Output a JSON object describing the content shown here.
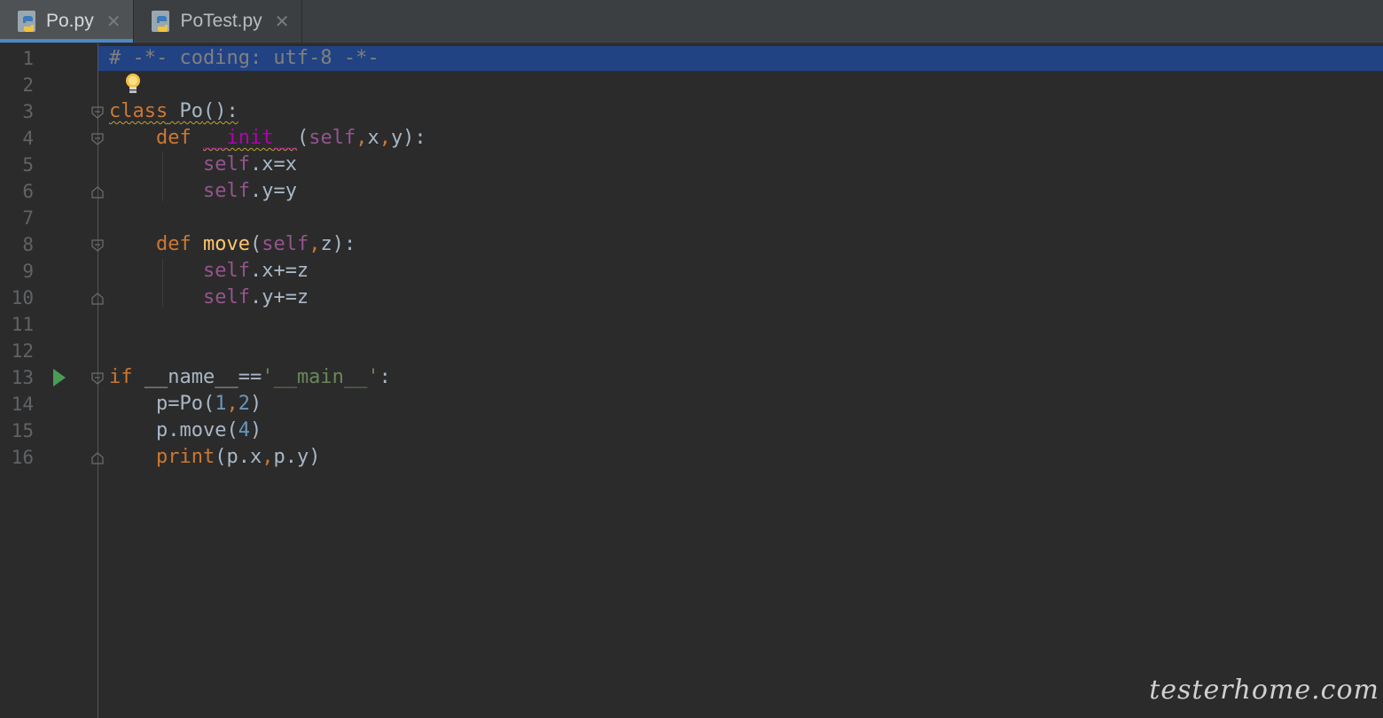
{
  "tabs": [
    {
      "label": "Po.py",
      "active": true
    },
    {
      "label": "PoTest.py",
      "active": false
    }
  ],
  "close_glyph": "✕",
  "line_numbers": [
    "1",
    "2",
    "3",
    "4",
    "5",
    "6",
    "7",
    "8",
    "9",
    "10",
    "11",
    "12",
    "13",
    "14",
    "15",
    "16"
  ],
  "code": {
    "l1": "# -*- coding: utf-8 -*-",
    "l3_kw": "class",
    "l3_name": "Po",
    "l3_rest": "():",
    "l4_kw": "def",
    "l4_name": "__init__",
    "l5_self": "self",
    "l5_rest": ".x=x",
    "l6_self": "self",
    "l6_rest": ".y=y",
    "l8_kw": "def",
    "l8_name": "move",
    "l9_self": "self",
    "l9_rest": ".x+=z",
    "l10_self": "self",
    "l10_rest": ".y+=z",
    "l13_kw": "if",
    "l13_mid": "__name__==",
    "l13_str": "'__main__'",
    "l13_end": ":",
    "l14_a": "p=Po(",
    "l14_n1": "1",
    "l14_n2": "2",
    "l14_end": ")",
    "l15_a": "p.move(",
    "l15_n": "4",
    "l15_end": ")",
    "l16_fn": "print",
    "l16_a": "(p.x",
    "l16_b": "p.y)"
  },
  "colors": {
    "background": "#2b2b2b",
    "keyword": "#cc7832",
    "self": "#94558d",
    "function": "#ffc66d",
    "string": "#6a8759",
    "number": "#6897bb",
    "comment": "#808080",
    "selection": "#214283"
  },
  "watermark": "testerhome.com"
}
